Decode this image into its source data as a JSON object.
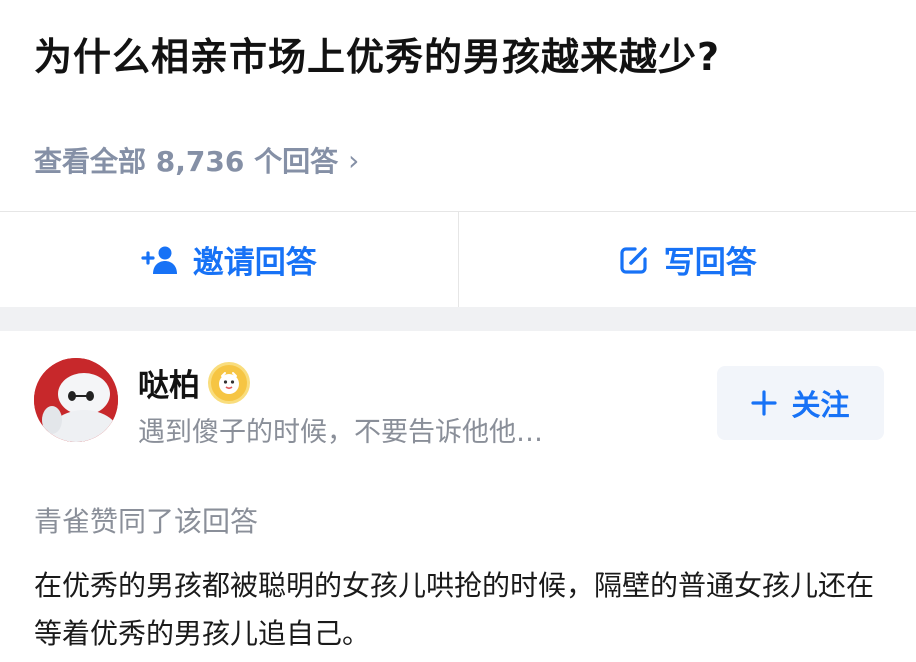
{
  "question": {
    "title": "为什么相亲市场上优秀的男孩越来越少?",
    "view_all_label": "查看全部 8,736 个回答"
  },
  "actions": {
    "invite_label": "邀请回答",
    "write_label": "写回答"
  },
  "author": {
    "name": "哒柏",
    "bio": "遇到傻子的时候，不要告诉他他…",
    "follow_label": "关注"
  },
  "answer": {
    "upvoted_by": "青雀赞同了该回答",
    "text": "在优秀的男孩都被聪明的女孩儿哄抢的时候，隔壁的普通女孩儿还在等着优秀的男孩儿追自己。"
  },
  "colors": {
    "accent": "#1772f6",
    "muted": "#8590a6",
    "badge": "#f6c543",
    "avatar_bg": "#c7282b"
  },
  "icons": [
    "add-user-icon",
    "edit-icon",
    "chevron-right-icon",
    "plus-icon",
    "creator-badge-icon"
  ]
}
